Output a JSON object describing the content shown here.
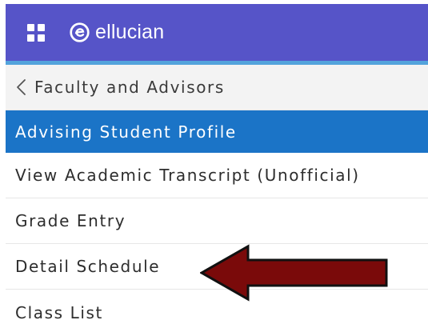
{
  "header": {
    "menu_icon": "grid-icon",
    "logo_icon": "ellucian-logo-icon",
    "brand": "ellucian"
  },
  "nav": {
    "back_label": "Faculty and Advisors",
    "back_icon": "chevron-left-icon",
    "items": [
      {
        "label": "Advising Student Profile",
        "active": true
      },
      {
        "label": "View Academic Transcript (Unofficial)",
        "active": false
      },
      {
        "label": "Grade Entry",
        "active": false
      },
      {
        "label": "Detail Schedule",
        "active": false
      },
      {
        "label": "Class List",
        "active": false
      }
    ]
  },
  "annotation": {
    "arrow_icon": "left-arrow-icon",
    "arrow_color": "#7a0a0a",
    "points_to": "Detail Schedule"
  },
  "colors": {
    "header_bg": "#5654c8",
    "accent_line": "#53a3dc",
    "active_bg": "#1b74c7",
    "back_bg": "#f3f3f3"
  }
}
